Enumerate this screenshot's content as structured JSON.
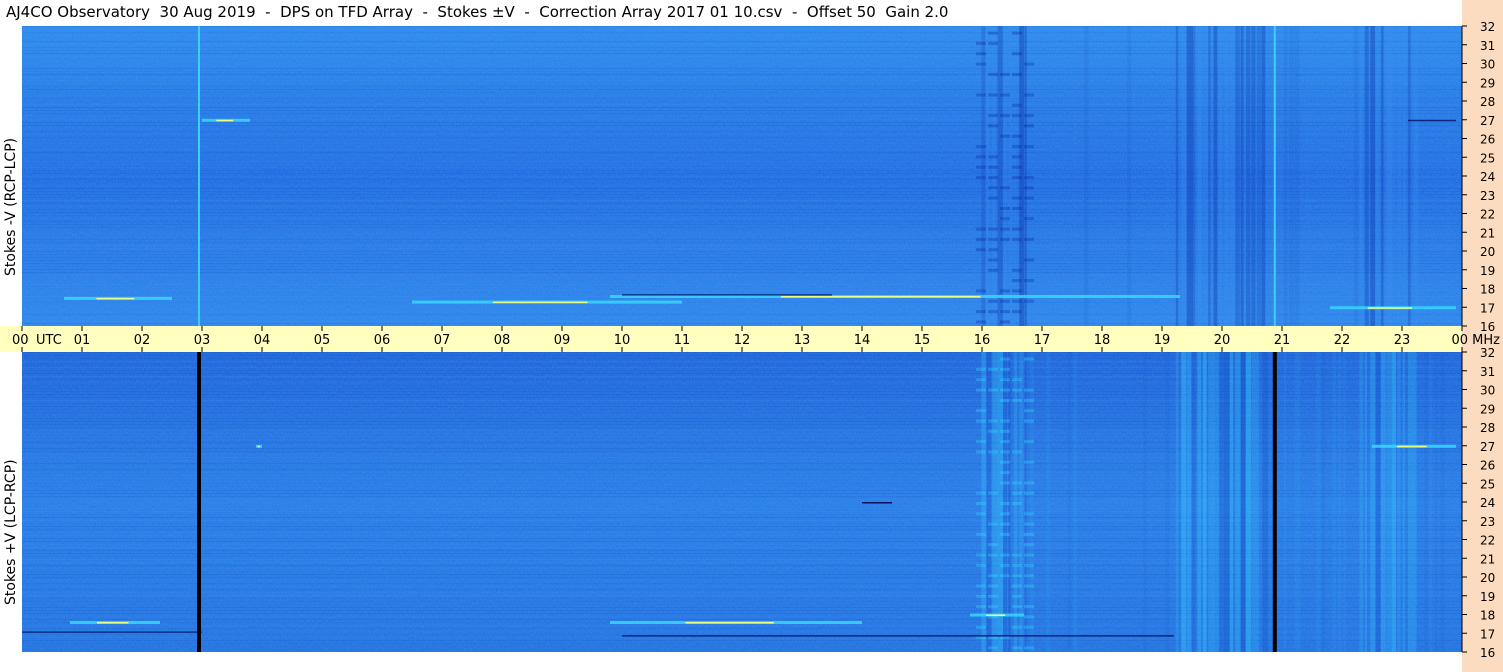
{
  "title": "AJ4CO Observatory  30 Aug 2019  -  DPS on TFD Array  -  Stokes ±V  -  Correction Array 2017 01 10.csv  -  Offset 50  Gain 2.0",
  "chart_data": [
    {
      "type": "heatmap",
      "panel": "top",
      "ylabel": "Stokes -V (RCP-LCP)",
      "yticks": [
        16,
        17,
        18,
        19,
        20,
        21,
        22,
        23,
        24,
        25,
        26,
        27,
        28,
        29,
        30,
        31,
        32
      ],
      "ylim": [
        16,
        32
      ],
      "xlim": [
        0,
        24
      ],
      "cursor_hour": 20.88,
      "marker_hour": 2.95,
      "bright_segments": [
        {
          "t0": 0.7,
          "t1": 2.5,
          "f": 17.5
        },
        {
          "t0": 6.5,
          "t1": 11.0,
          "f": 17.3
        },
        {
          "t0": 9.8,
          "t1": 19.3,
          "f": 17.6
        },
        {
          "t0": 21.8,
          "t1": 23.9,
          "f": 17.0
        },
        {
          "t0": 3.0,
          "t1": 3.8,
          "f": 27.0
        }
      ]
    },
    {
      "type": "heatmap",
      "panel": "bottom",
      "ylabel": "Stokes +V (LCP-RCP)",
      "yticks": [
        16,
        17,
        18,
        19,
        20,
        21,
        22,
        23,
        24,
        25,
        26,
        27,
        28,
        29,
        30,
        31,
        32
      ],
      "ylim": [
        16,
        32
      ],
      "xlim": [
        0,
        24
      ],
      "cursor_hour": 20.88,
      "marker_hour": 2.95,
      "bright_segments": [
        {
          "t0": 0.8,
          "t1": 2.3,
          "f": 17.6
        },
        {
          "t0": 9.8,
          "t1": 14.0,
          "f": 17.6
        },
        {
          "t0": 15.8,
          "t1": 16.7,
          "f": 18.0
        },
        {
          "t0": 3.9,
          "t1": 4.0,
          "f": 27.0
        },
        {
          "t0": 22.5,
          "t1": 23.9,
          "f": 27.0
        }
      ]
    }
  ],
  "time_axis": {
    "labels": [
      "00",
      "01",
      "02",
      "03",
      "04",
      "05",
      "06",
      "07",
      "08",
      "09",
      "10",
      "11",
      "12",
      "13",
      "14",
      "15",
      "16",
      "17",
      "18",
      "19",
      "20",
      "21",
      "22",
      "23",
      "00"
    ],
    "unit_left": "UTC",
    "unit_right": "MHz"
  },
  "colors": {
    "axis_band": "#ffffc0",
    "right_strip": "#fcdcc0",
    "background_blue": "#1f6fe0",
    "dark_blue": "#0a2fa8",
    "cyan": "#36d8ff",
    "bright": "#e8ff80",
    "cursor_top": "#3fd7ff",
    "cursor_bottom": "#000000"
  }
}
